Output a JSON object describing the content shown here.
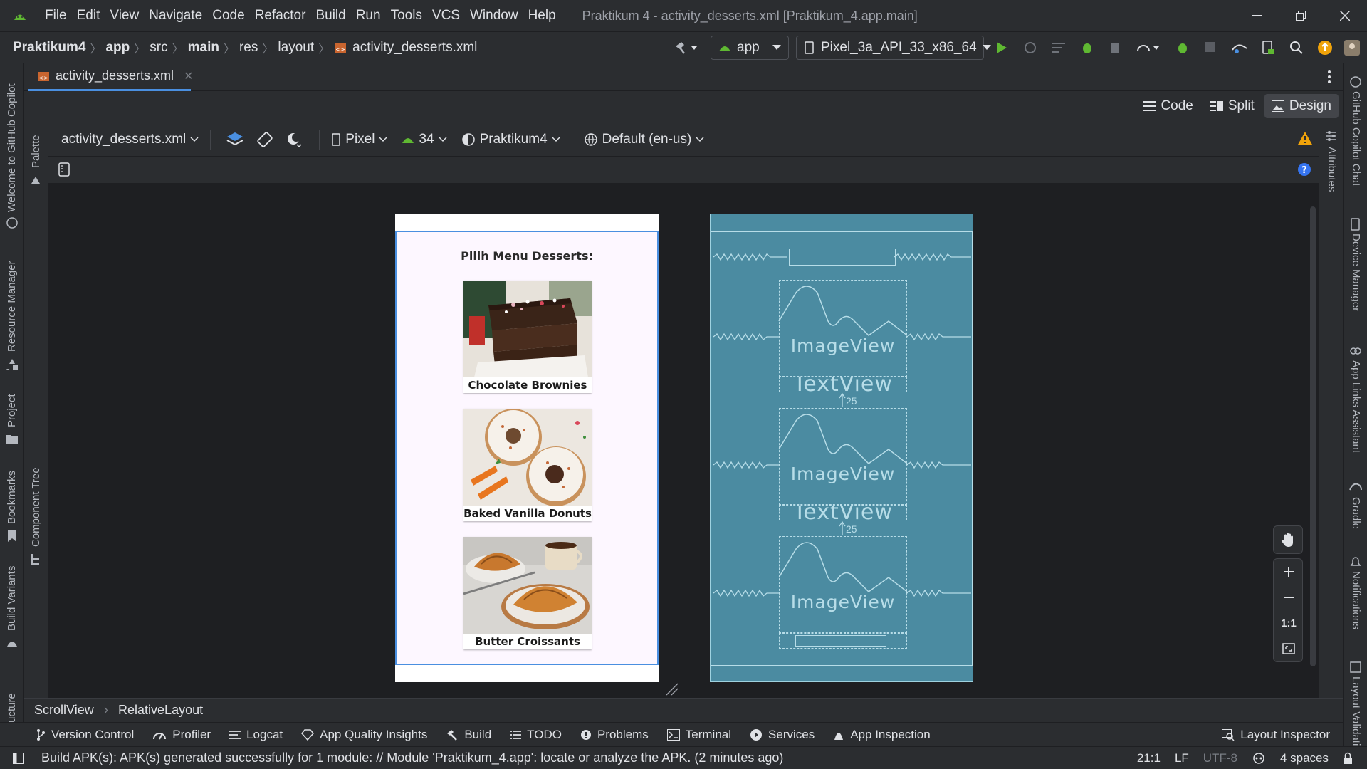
{
  "window": {
    "title": "Praktikum 4 - activity_desserts.xml [Praktikum_4.app.main]"
  },
  "menu": [
    "File",
    "Edit",
    "View",
    "Navigate",
    "Code",
    "Refactor",
    "Build",
    "Run",
    "Tools",
    "VCS",
    "Window",
    "Help"
  ],
  "breadcrumb": {
    "project": "Praktikum4",
    "module": "app",
    "src": "src",
    "main": "main",
    "res": "res",
    "layout": "layout",
    "file": "activity_desserts.xml"
  },
  "run_config": {
    "module": "app",
    "device": "Pixel_3a_API_33_x86_64"
  },
  "editor_tab": {
    "label": "activity_desserts.xml"
  },
  "view_modes": {
    "code": "Code",
    "split": "Split",
    "design": "Design",
    "active": "Design"
  },
  "design_toolbar": {
    "file": "activity_desserts.xml",
    "device": "Pixel",
    "api": "34",
    "theme": "Praktikum4",
    "locale": "Default (en-us)"
  },
  "side_tools_left": [
    "Welcome to GitHub Copilot",
    "Resource Manager",
    "Project",
    "Bookmarks",
    "Build Variants",
    "Structure"
  ],
  "side_tools_right": [
    "GitHub Copilot Chat",
    "Device Manager",
    "App Links Assistant",
    "Gradle",
    "Notifications",
    "Layout Validation"
  ],
  "palette_label": "Palette",
  "component_tree_label": "Component Tree",
  "attributes_label": "Attributes",
  "preview": {
    "heading": "Pilih Menu Desserts:",
    "items": [
      {
        "name": "Chocolate Brownies",
        "image": "brownies-photo"
      },
      {
        "name": "Baked Vanilla Donuts",
        "image": "donuts-photo"
      },
      {
        "name": "Butter Croissants",
        "image": "croissants-photo"
      }
    ]
  },
  "blueprint": {
    "image_label": "ImageView",
    "text_label": "TextView",
    "margin_value": "25"
  },
  "zoom_controls": {
    "one_to_one": "1:1"
  },
  "component_path": [
    "ScrollView",
    "RelativeLayout"
  ],
  "tool_windows": [
    "Version Control",
    "Profiler",
    "Logcat",
    "App Quality Insights",
    "Build",
    "TODO",
    "Problems",
    "Terminal",
    "Services",
    "App Inspection"
  ],
  "layout_inspector": "Layout Inspector",
  "status": {
    "message": "Build APK(s): APK(s) generated successfully for 1 module: // Module 'Praktikum_4.app': locate or analyze the APK. (2 minutes ago)",
    "position": "21:1",
    "line_ending": "LF",
    "encoding": "UTF-8",
    "indent": "4 spaces"
  },
  "colors": {
    "accent_green": "#5fb832",
    "warning": "#f0a30a",
    "blueprint": "#4b8ba1",
    "selection_blue": "#4a8fe0"
  }
}
